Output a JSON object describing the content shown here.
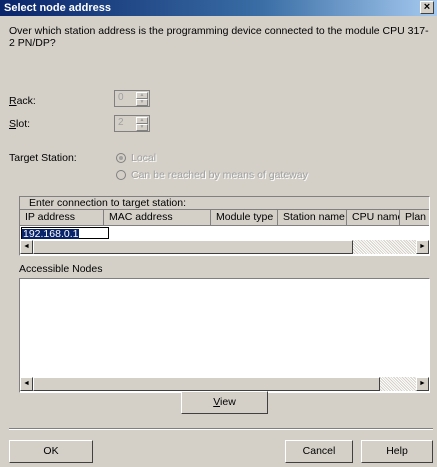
{
  "window": {
    "title": "Select node address",
    "close_label": "×"
  },
  "question": "Over which station address is the programming device connected to the module CPU 317-2 PN/DP?",
  "rack": {
    "label_hotkey": "R",
    "label_rest": "ack:",
    "value": "0"
  },
  "slot": {
    "label_hotkey": "S",
    "label_rest": "lot:",
    "value": "2"
  },
  "target": {
    "label": "Target Station:",
    "options": [
      {
        "label": "Local",
        "selected": true
      },
      {
        "label": "Can be reached by means of gateway",
        "selected": false
      }
    ]
  },
  "connection_table": {
    "caption": "Enter connection to target station:",
    "columns": [
      "IP address",
      "MAC address",
      "Module type",
      "Station name",
      "CPU name",
      "Plan"
    ],
    "rows": [
      {
        "ip_address": "192.168.0.1"
      }
    ]
  },
  "accessible_nodes": {
    "label": "Accessible Nodes"
  },
  "buttons": {
    "view_hotkey": "V",
    "view_rest": "iew",
    "ok": "OK",
    "cancel": "Cancel",
    "help": "Help"
  },
  "icons": {
    "scroll_left": "◄",
    "scroll_right": "►",
    "spin_up": "▲",
    "spin_down": "▼"
  }
}
